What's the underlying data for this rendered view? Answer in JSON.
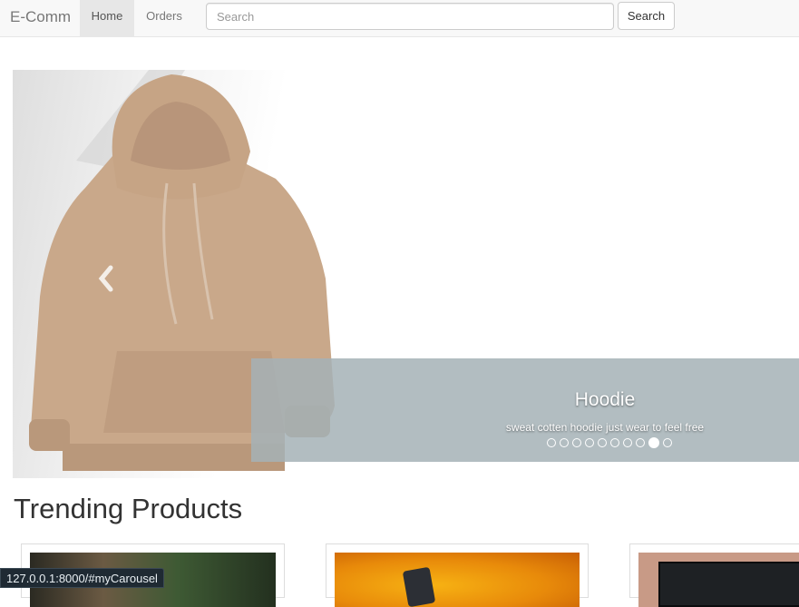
{
  "navbar": {
    "brand": "E-Comm",
    "home_label": "Home",
    "orders_label": "Orders",
    "search_placeholder": "Search",
    "search_button_label": "Search"
  },
  "carousel": {
    "caption_title": "Hoodie",
    "caption_text": "sweat cotten hoodie just wear to feel free",
    "slide_count": 10,
    "active_index": 8
  },
  "trending": {
    "title": "Trending Products"
  },
  "status_bar": {
    "url": "127.0.0.1:8000/#myCarousel"
  }
}
